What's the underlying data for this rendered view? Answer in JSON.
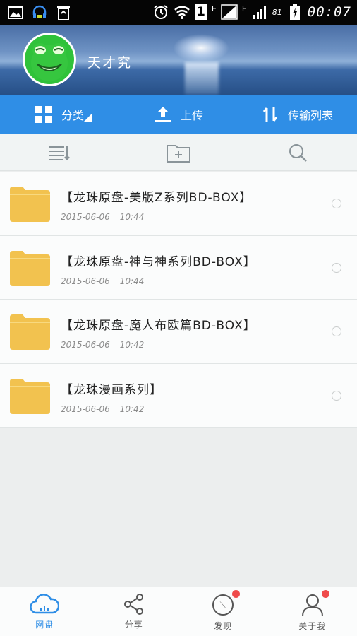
{
  "status_bar": {
    "signal_label": "1",
    "net1": "E",
    "net2": "E",
    "battery": "81",
    "time": "00:07"
  },
  "profile": {
    "username": "天才究"
  },
  "toolbar": {
    "category_label": "分类",
    "upload_label": "上传",
    "transfer_label": "传输列表"
  },
  "files": [
    {
      "name": "【龙珠原盘-美版Z系列BD-BOX】",
      "date": "2015-06-06",
      "time": "10:44"
    },
    {
      "name": "【龙珠原盘-神与神系列BD-BOX】",
      "date": "2015-06-06",
      "time": "10:44"
    },
    {
      "name": "【龙珠原盘-魔人布欧篇BD-BOX】",
      "date": "2015-06-06",
      "time": "10:42"
    },
    {
      "name": "【龙珠漫画系列】",
      "date": "2015-06-06",
      "time": "10:42"
    }
  ],
  "bottom_nav": {
    "items": [
      {
        "label": "网盘",
        "icon": "cloud-icon",
        "active": true
      },
      {
        "label": "分享",
        "icon": "share-icon",
        "active": false
      },
      {
        "label": "发现",
        "icon": "compass-icon",
        "active": false
      },
      {
        "label": "关于我",
        "icon": "user-icon",
        "active": false
      }
    ]
  },
  "colors": {
    "accent": "#2f8ee6",
    "folder": "#f2c24f",
    "badge": "#ef4b4b"
  }
}
